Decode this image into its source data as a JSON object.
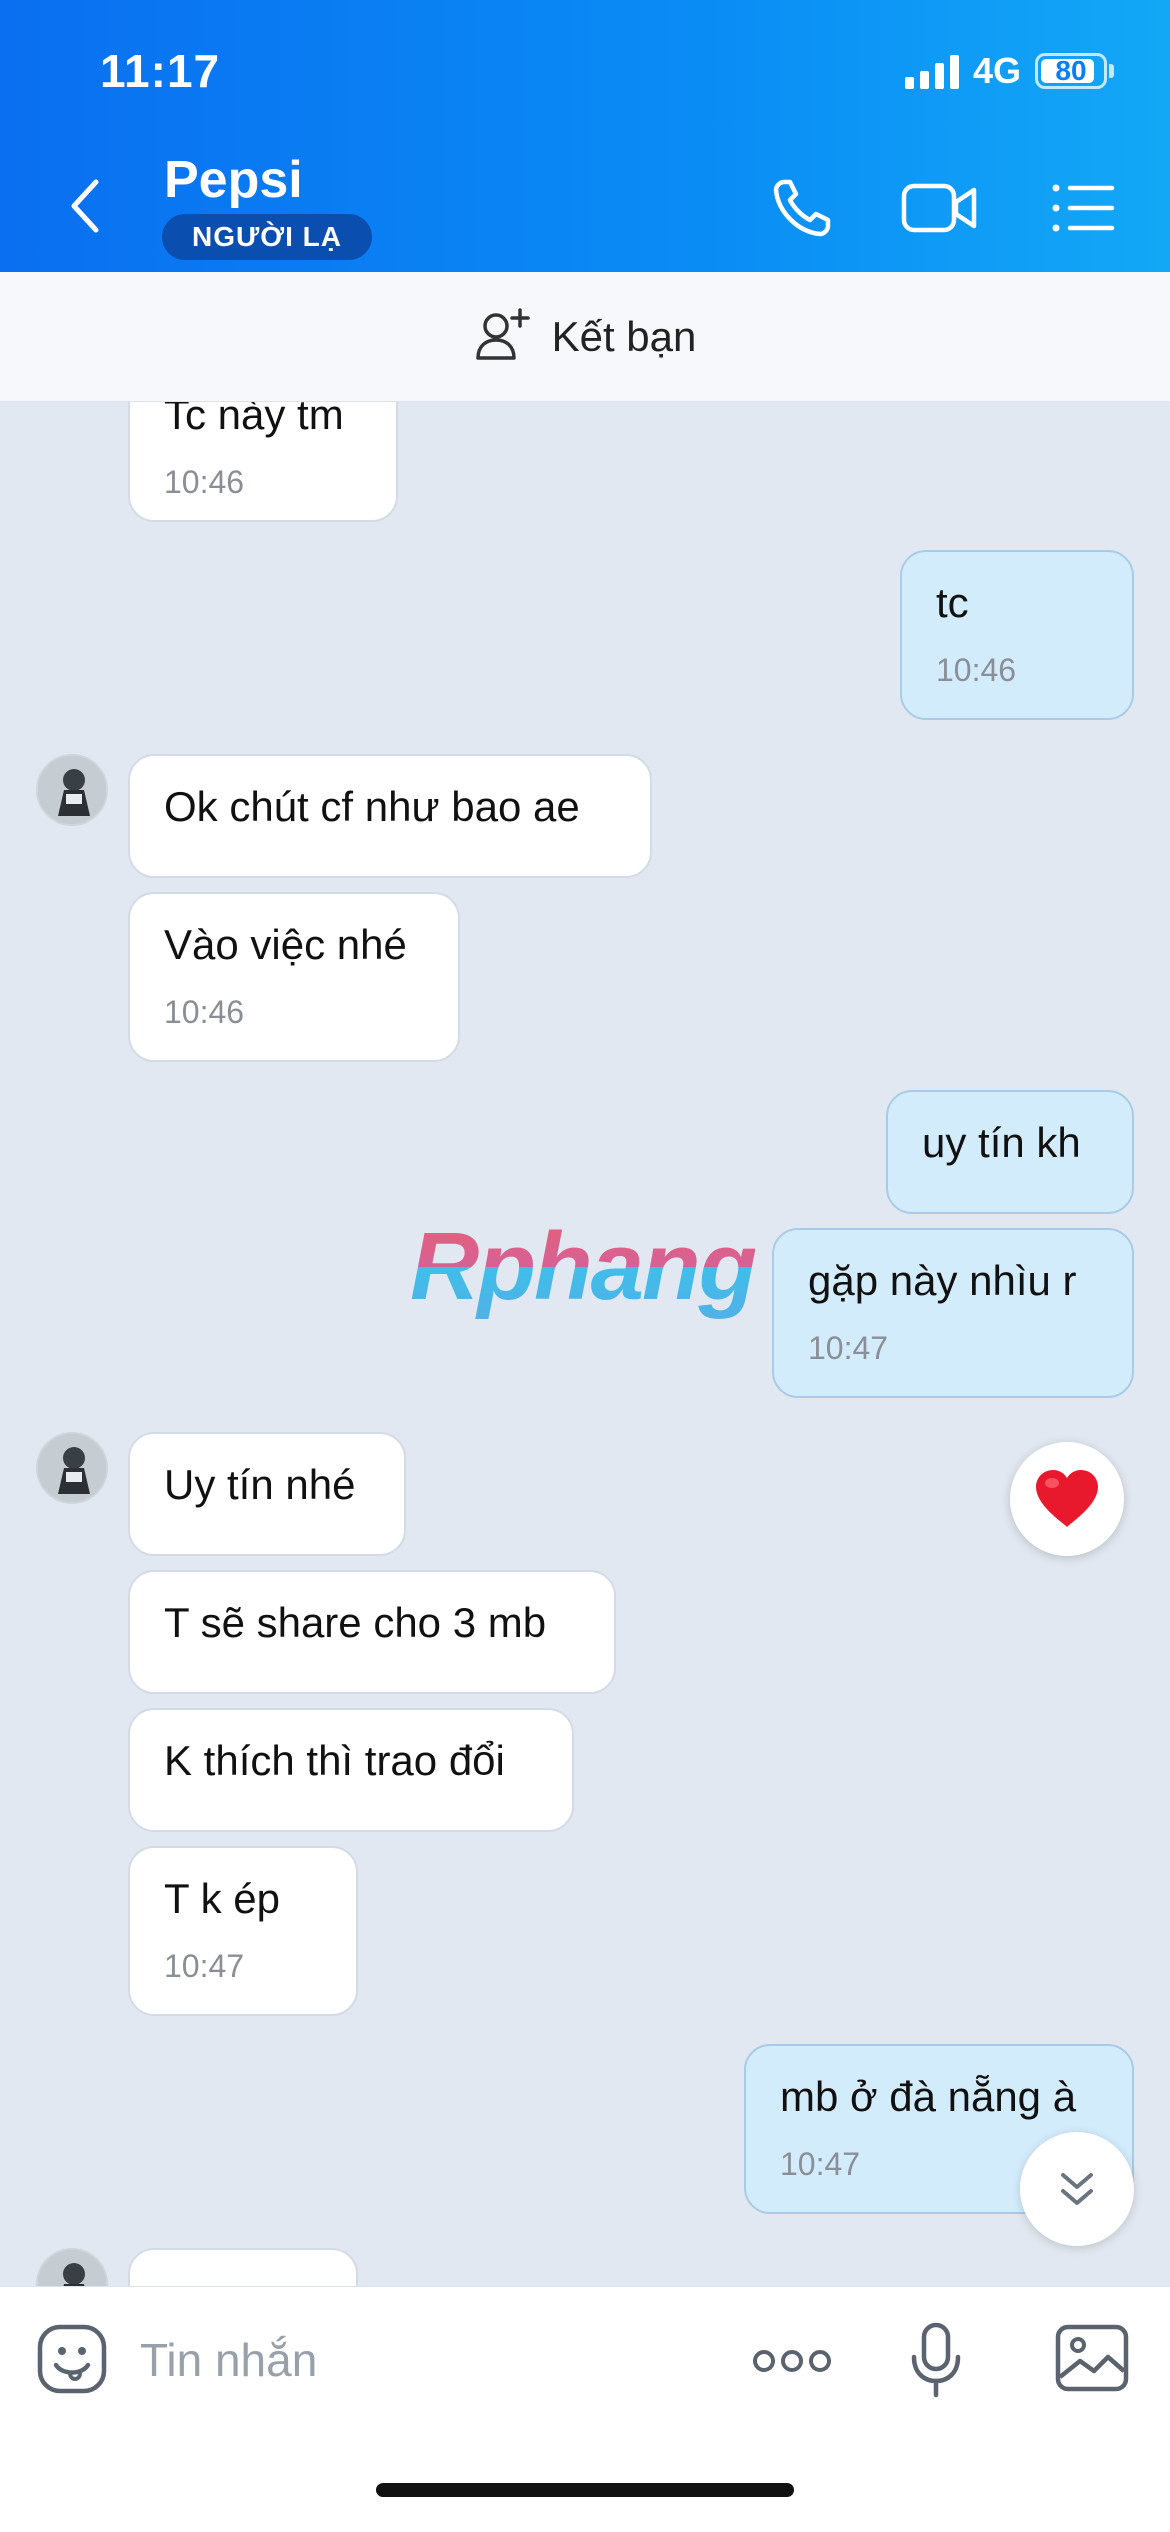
{
  "status_bar": {
    "time": "11:17",
    "network": "4G",
    "battery": "80"
  },
  "header": {
    "contact_name": "Pepsi",
    "badge": "NGƯỜI LẠ",
    "icons": [
      "back-icon",
      "phone-icon",
      "video-call-icon",
      "menu-list-icon"
    ]
  },
  "add_friend": {
    "label": "Kết bạn",
    "icon": "add-user-icon"
  },
  "messages": [
    {
      "side": "in",
      "text": "Tc này tm",
      "time": "10:46"
    },
    {
      "side": "out",
      "text": "tc",
      "time": "10:46"
    },
    {
      "side": "in",
      "text": "Ok chút cf như bao ae",
      "time": ""
    },
    {
      "side": "in",
      "text": "Vào việc nhé",
      "time": "10:46"
    },
    {
      "side": "out",
      "text": "uy tín kh",
      "time": ""
    },
    {
      "side": "out",
      "text": "gặp này nhìu r",
      "time": "10:47"
    },
    {
      "side": "in",
      "text": "Uy tín nhé",
      "time": ""
    },
    {
      "side": "in",
      "text": "T sẽ share cho 3 mb",
      "time": ""
    },
    {
      "side": "in",
      "text": "K thích thì trao đổi",
      "time": ""
    },
    {
      "side": "in",
      "text": "T k ép",
      "time": "10:47"
    },
    {
      "side": "out",
      "text": "mb ở đà nẵng à",
      "time": "10:47"
    }
  ],
  "watermark": "Rphang",
  "composer": {
    "placeholder": "Tin nhắn",
    "icons": [
      "emoji-icon",
      "more-icon",
      "microphone-icon",
      "image-icon"
    ]
  },
  "colors": {
    "header_start": "#0a6ff0",
    "header_end": "#13a8f6",
    "out_bubble": "#d3ecfc",
    "in_bubble": "#ffffff",
    "chat_bg": "#e2e8f1"
  }
}
